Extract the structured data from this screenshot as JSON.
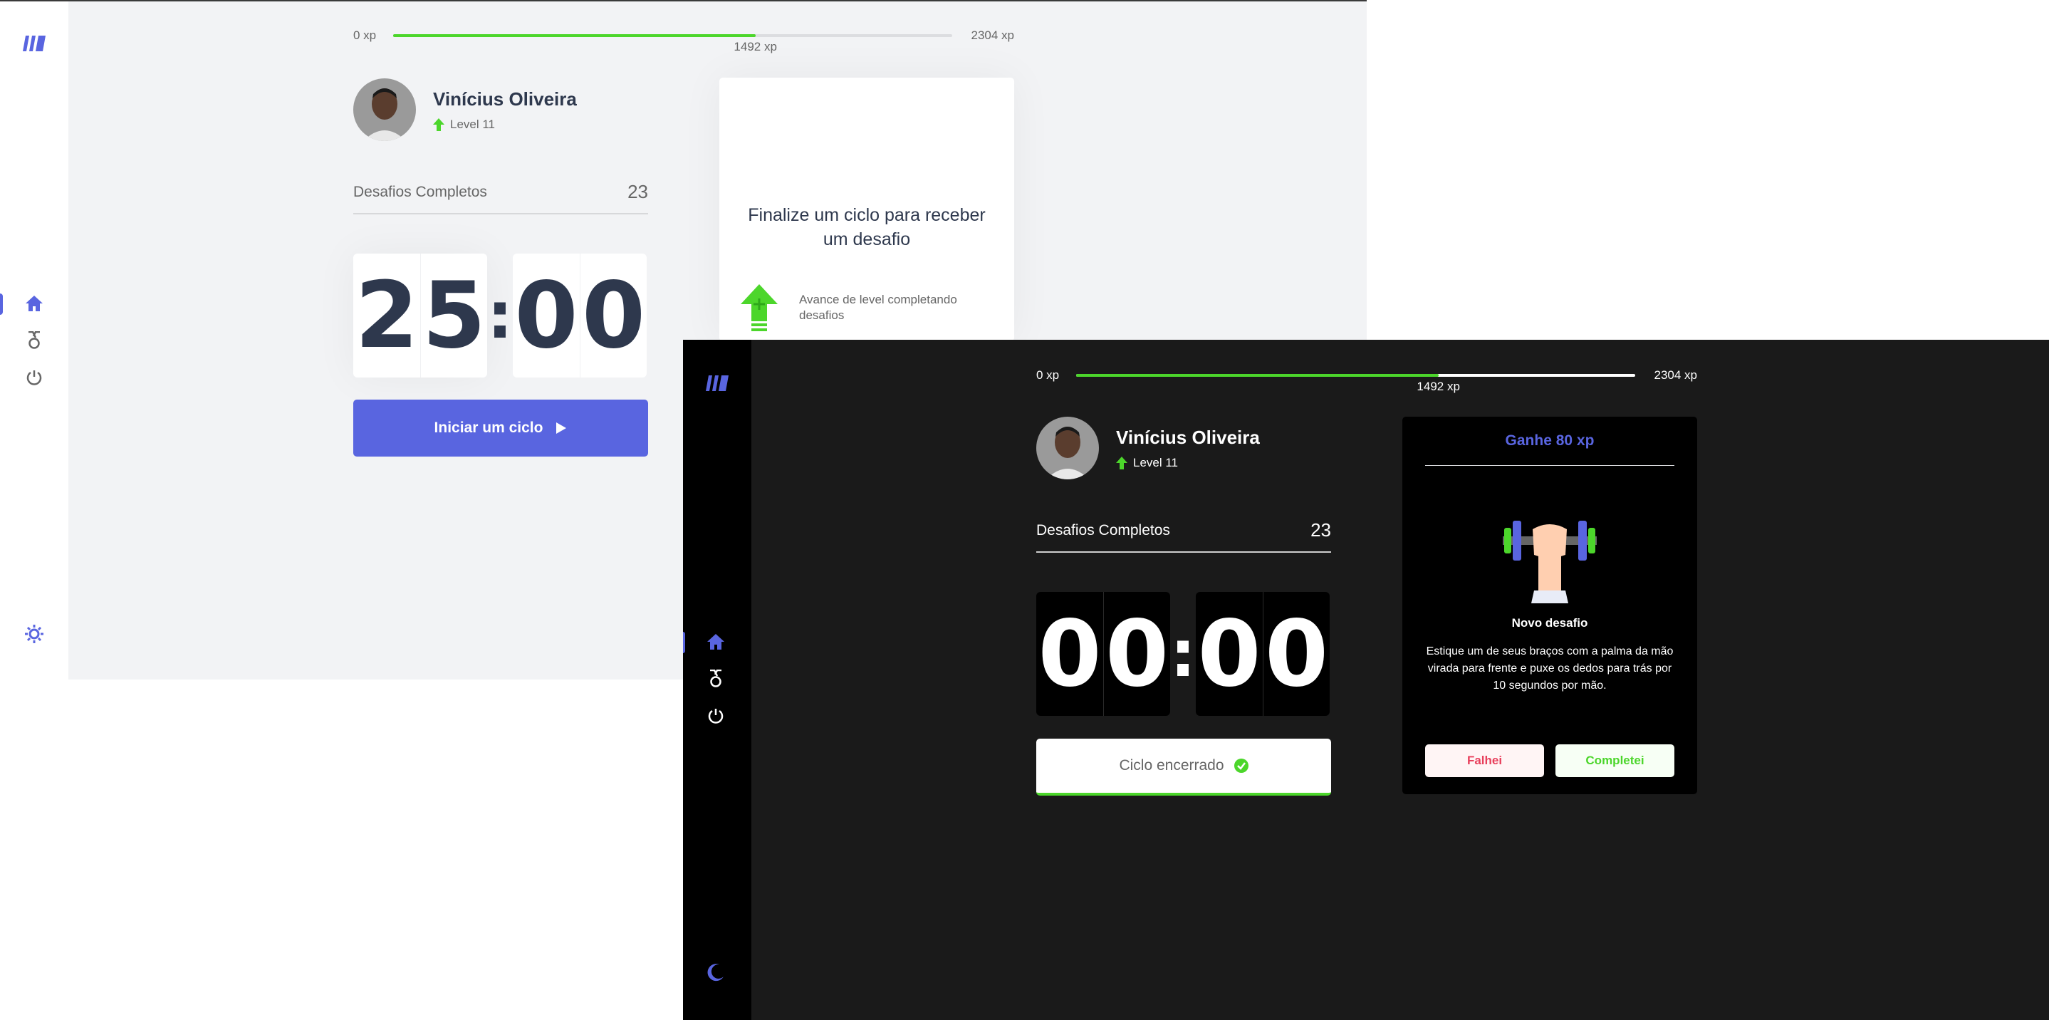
{
  "light": {
    "xp": {
      "min": "0 xp",
      "max": "2304 xp",
      "current": "1492 xp",
      "progress": 0.648
    },
    "profile": {
      "name": "Vinícius Oliveira",
      "level": "Level 11"
    },
    "completed": {
      "label": "Desafios Completos",
      "value": "23"
    },
    "timer": {
      "m1": "2",
      "m2": "5",
      "s1": "0",
      "s2": "0",
      "colon": ":"
    },
    "start_button": {
      "label": "Iniciar um ciclo"
    },
    "card": {
      "title": "Finalize um ciclo para receber um desafio",
      "hint": "Avance de level completando desafios"
    },
    "icons": [
      "logo-icon",
      "home-icon",
      "medal-icon",
      "power-icon",
      "sun-icon"
    ]
  },
  "dark": {
    "xp": {
      "min": "0 xp",
      "max": "2304 xp",
      "current": "1492 xp",
      "progress": 0.648
    },
    "profile": {
      "name": "Vinícius Oliveira",
      "level": "Level 11"
    },
    "completed": {
      "label": "Desafios Completos",
      "value": "23"
    },
    "timer": {
      "m1": "0",
      "m2": "0",
      "s1": "0",
      "s2": "0",
      "colon": ":"
    },
    "cycle_button": {
      "label": "Ciclo encerrado"
    },
    "challenge": {
      "header": "Ganhe 80 xp",
      "title": "Novo desafio",
      "description": "Estique um de seus braços com a palma da mão virada para frente e puxe os dedos para trás por 10 segundos por mão.",
      "fail_label": "Falhei",
      "success_label": "Completei"
    },
    "icons": [
      "logo-icon",
      "home-icon",
      "medal-icon",
      "power-icon",
      "moon-icon"
    ]
  },
  "colors": {
    "accent": "#5965e0",
    "green": "#4cd62b",
    "red": "#e83f5b",
    "text_light": "#2e384d",
    "text_muted": "#666666",
    "dark_bg": "#1a1a1a"
  }
}
